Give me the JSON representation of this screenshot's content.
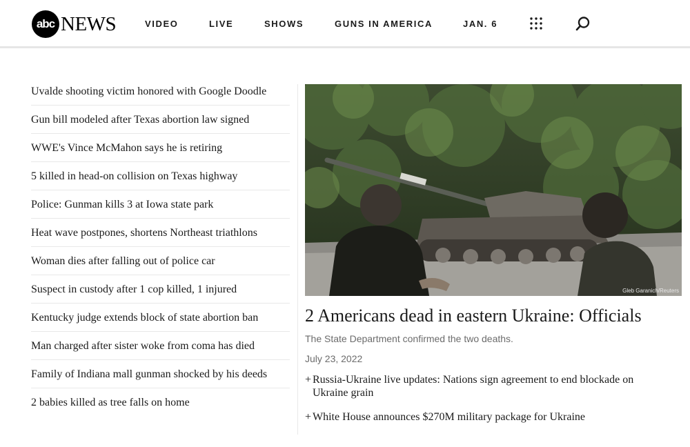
{
  "header": {
    "logo_badge": "abc",
    "logo_word": "NEWS",
    "nav": [
      "VIDEO",
      "LIVE",
      "SHOWS",
      "GUNS IN AMERICA",
      "JAN. 6"
    ]
  },
  "headlines": [
    "Uvalde shooting victim honored with Google Doodle",
    "Gun bill modeled after Texas abortion law signed",
    "WWE's Vince McMahon says he is retiring",
    "5 killed in head-on collision on Texas highway",
    "Police: Gunman kills 3 at Iowa state park",
    "Heat wave postpones, shortens Northeast triathlons",
    "Woman dies after falling out of police car",
    "Suspect in custody after 1 cop killed, 1 injured",
    "Kentucky judge extends block of state abortion ban",
    "Man charged after sister woke from coma has died",
    "Family of Indiana mall gunman shocked by his deeds",
    "2 babies killed as tree falls on home"
  ],
  "main_story": {
    "photo_credit": "Gleb Garanich/Reuters",
    "title": "2 Americans dead in eastern Ukraine: Officials",
    "description": "The State Department confirmed the two deaths.",
    "date": "July 23, 2022",
    "related": [
      {
        "marker": "+",
        "text": "Russia-Ukraine live updates: Nations sign agreement to end blockade on Ukraine grain"
      },
      {
        "marker": "+",
        "text": "White House announces $270M military package for Ukraine"
      }
    ]
  }
}
